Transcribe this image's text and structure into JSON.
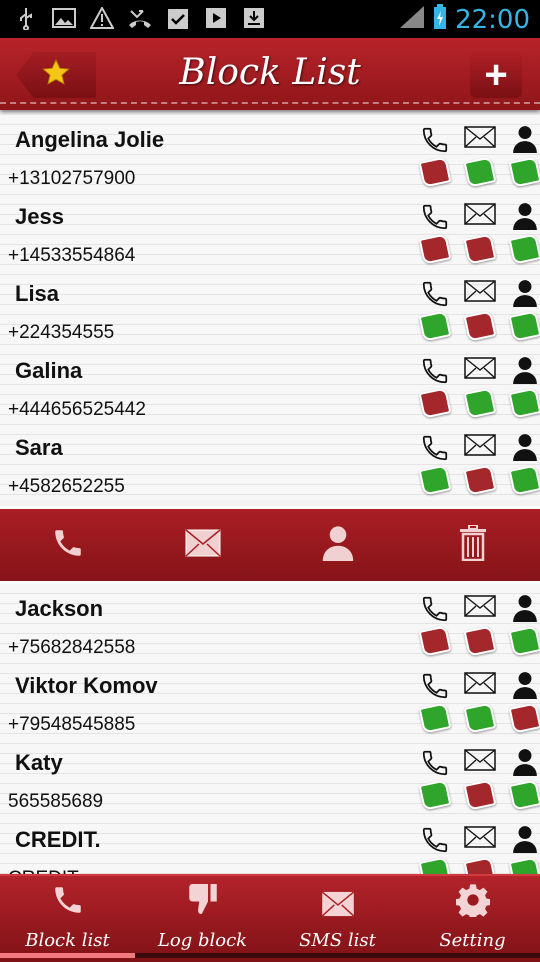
{
  "status_bar": {
    "time": "22:00"
  },
  "header": {
    "title": "Block List",
    "add_label": "+"
  },
  "contacts_top": [
    {
      "name": "Angelina Jolie",
      "phone": "+13102757900",
      "call": "blocked",
      "sms": "allowed",
      "contact": "allowed"
    },
    {
      "name": "Jess",
      "phone": "+14533554864",
      "call": "blocked",
      "sms": "blocked",
      "contact": "allowed"
    },
    {
      "name": "Lisa",
      "phone": "+224354555",
      "call": "allowed",
      "sms": "blocked",
      "contact": "allowed"
    },
    {
      "name": "Galina",
      "phone": "+444656525442",
      "call": "blocked",
      "sms": "allowed",
      "contact": "allowed"
    },
    {
      "name": "Sara",
      "phone": "+4582652255",
      "call": "allowed",
      "sms": "blocked",
      "contact": "allowed"
    }
  ],
  "contacts_bottom": [
    {
      "name": "Jackson",
      "phone": "+75682842558",
      "call": "blocked",
      "sms": "blocked",
      "contact": "allowed"
    },
    {
      "name": "Viktor Komov",
      "phone": "+79548545885",
      "call": "allowed",
      "sms": "allowed",
      "contact": "blocked"
    },
    {
      "name": "Katy",
      "phone": "565585689",
      "call": "allowed",
      "sms": "blocked",
      "contact": "allowed"
    },
    {
      "name": "CREDIT.",
      "phone": "CREDIT",
      "call": "allowed",
      "sms": "blocked",
      "contact": "allowed"
    }
  ],
  "colors": {
    "allowed": "#2fa52b",
    "blocked": "#a3272b",
    "accent": "#a91e24"
  },
  "bottom_nav": {
    "tabs": [
      {
        "label": "Block list",
        "icon": "phone-icon"
      },
      {
        "label": "Log block",
        "icon": "thumbs-down-icon"
      },
      {
        "label": "SMS list",
        "icon": "envelope-icon"
      },
      {
        "label": "Setting",
        "icon": "gear-icon"
      }
    ],
    "active_index": 0
  }
}
